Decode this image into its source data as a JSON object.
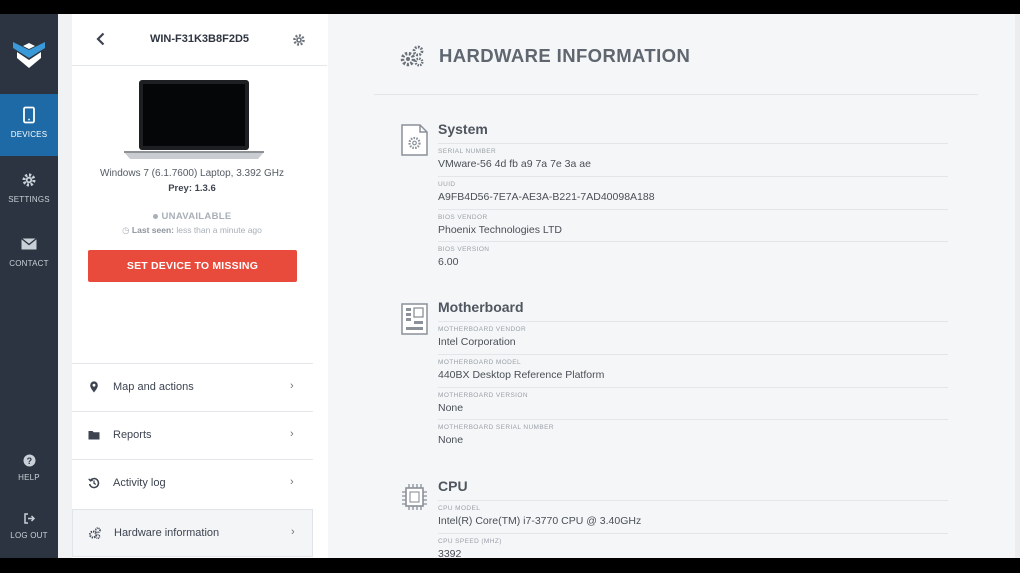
{
  "rail": {
    "logo": "prey-shield-logo",
    "items": [
      {
        "label": "DEVICES",
        "icon": "tablet-icon"
      },
      {
        "label": "SETTINGS",
        "icon": "gear-icon"
      },
      {
        "label": "CONTACT",
        "icon": "envelope-icon"
      }
    ],
    "bottom": [
      {
        "label": "HELP",
        "icon": "question-icon"
      },
      {
        "label": "LOG OUT",
        "icon": "logout-icon"
      }
    ]
  },
  "device": {
    "name": "WIN-F31K3B8F2D5",
    "description": "Windows 7 (6.1.7600) Laptop, 3.392 GHz",
    "prey_version": "Prey: 1.3.6",
    "status": "UNAVAILABLE",
    "last_seen_label": "Last seen:",
    "last_seen_value": "less than a minute ago",
    "missing_button": "SET DEVICE TO MISSING"
  },
  "menu": [
    {
      "label": "Map and actions",
      "icon": "map-pin-icon"
    },
    {
      "label": "Reports",
      "icon": "folder-icon"
    },
    {
      "label": "Activity log",
      "icon": "history-icon"
    },
    {
      "label": "Hardware information",
      "icon": "cogs-icon"
    }
  ],
  "main": {
    "title": "HARDWARE INFORMATION",
    "sections": [
      {
        "title": "System",
        "icon": "file-settings-icon",
        "fields": [
          {
            "label": "SERIAL NUMBER",
            "value": "VMware-56 4d fb a9 7a 7e 3a ae"
          },
          {
            "label": "UUID",
            "value": "A9FB4D56-7E7A-AE3A-B221-7AD40098A188"
          },
          {
            "label": "BIOS VENDOR",
            "value": "Phoenix Technologies LTD"
          },
          {
            "label": "BIOS VERSION",
            "value": "6.00"
          }
        ]
      },
      {
        "title": "Motherboard",
        "icon": "motherboard-icon",
        "fields": [
          {
            "label": "MOTHERBOARD VENDOR",
            "value": "Intel Corporation"
          },
          {
            "label": "MOTHERBOARD MODEL",
            "value": "440BX Desktop Reference Platform"
          },
          {
            "label": "MOTHERBOARD VERSION",
            "value": "None"
          },
          {
            "label": "MOTHERBOARD SERIAL NUMBER",
            "value": "None"
          }
        ]
      },
      {
        "title": "CPU",
        "icon": "cpu-icon",
        "fields": [
          {
            "label": "CPU MODEL",
            "value": "Intel(R) Core(TM) i7-3770 CPU @ 3.40GHz"
          },
          {
            "label": "CPU SPEED (MHZ)",
            "value": "3392"
          }
        ]
      }
    ]
  },
  "colors": {
    "rail_bg": "#2b3440",
    "rail_active": "#1e6aa6",
    "danger": "#e84b3c"
  }
}
